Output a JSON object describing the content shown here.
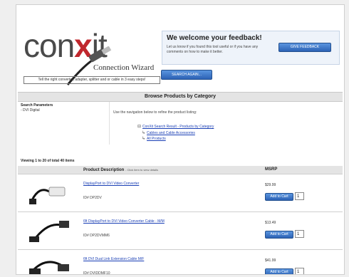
{
  "brand": {
    "logo_word_part1": "con",
    "logo_word_x": "x",
    "logo_word_part2": "it",
    "logo_sub": "Connection Wizard",
    "tagline": "Tell the right converter, adapter, splitter and or cable in 3 easy steps!",
    "colors": {
      "accent": "#c0272d",
      "button": "#2c62b5",
      "link": "#1a3fb5"
    }
  },
  "feedback": {
    "title": "We welcome your feedback!",
    "text": "Let us know if you found this tool useful or if you have any comments on how to make it better.",
    "button": "GIVE FEEDBACK"
  },
  "search_again_button": "SEARCH AGAIN...",
  "category_bar": "Browse Products by Category",
  "search_params": {
    "label": "Search Parameters",
    "value": "- DVI Digital"
  },
  "navigation": {
    "instructions": "Use the navigation below to refine the product listing:",
    "root_link": "ConXit Search Result - Products by Category",
    "children": [
      "Cables and Cable Accessories",
      "All Products"
    ]
  },
  "listing": {
    "viewing_text": "Viewing 1 to 20 of total 40 items",
    "col_description": "Product Description",
    "col_description_hint": "- Click item to view details",
    "col_msrp": "MSRP",
    "add_to_cart_label": "Add to Cart",
    "products": [
      {
        "name": "DisplayPort to DVI Video Converter",
        "id": "ID# DP2DV",
        "price": "$29.99",
        "qty": "1",
        "image": "adapter-cable-icon"
      },
      {
        "name": "6ft DisplayPort to DVI Video Converter Cable - M/M",
        "id": "ID# DP2DVMM6",
        "price": "$13.49",
        "qty": "1",
        "image": "cable-icon"
      },
      {
        "name": "6ft DVI Dual Link Extension Cable M/F",
        "id": "ID# DVIDDMF10",
        "price": "$41.99",
        "qty": "1",
        "image": "dvi-cable-icon"
      }
    ]
  }
}
